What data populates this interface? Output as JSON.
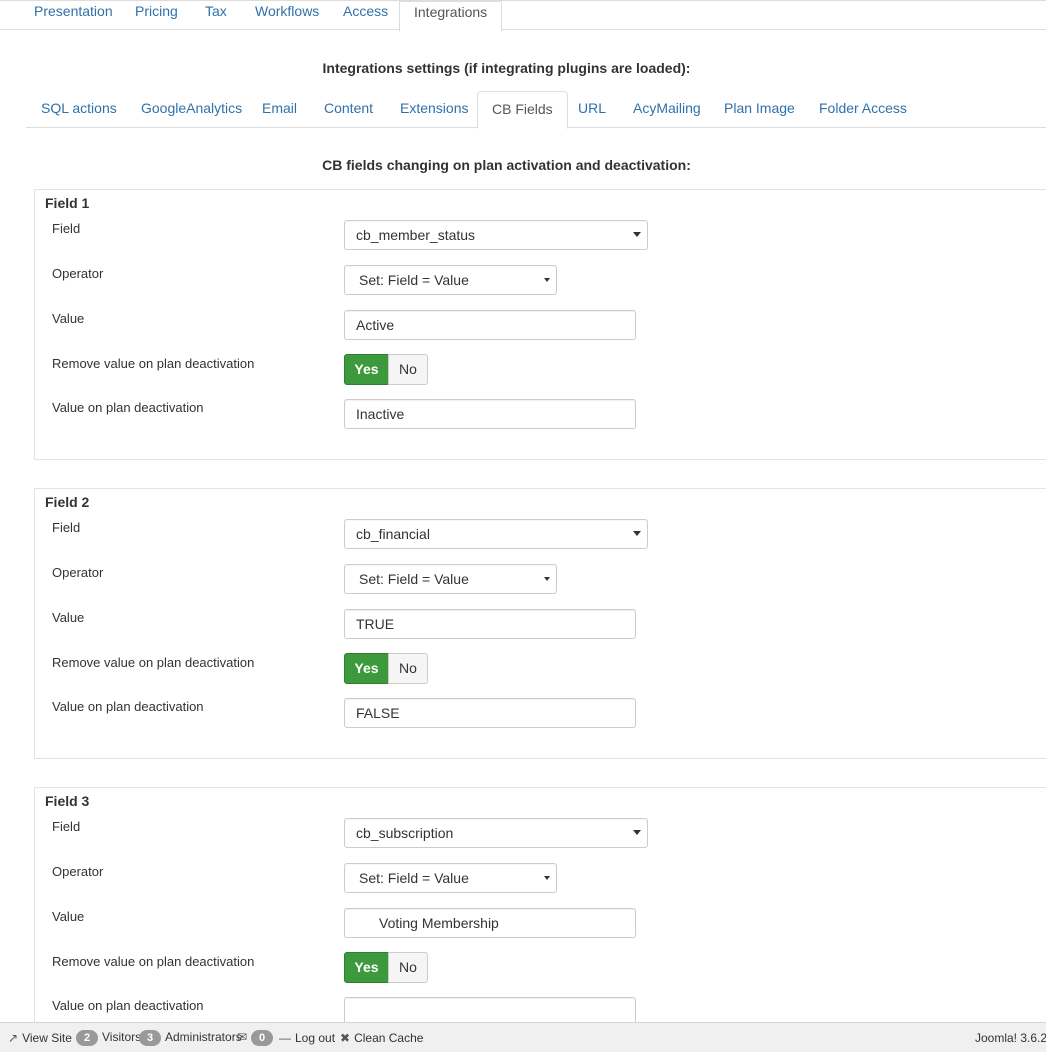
{
  "top_tabs": [
    "Presentation",
    "Pricing",
    "Tax",
    "Workflows",
    "Access",
    "Integrations"
  ],
  "top_active": "Integrations",
  "integrations_heading": "Integrations settings (if integrating plugins are loaded):",
  "sub_tabs": [
    "SQL actions",
    "GoogleAnalytics",
    "Email",
    "Content",
    "Extensions",
    "CB Fields",
    "URL",
    "AcyMailing",
    "Plan Image",
    "Folder Access"
  ],
  "sub_active": "CB Fields",
  "cb_heading": "CB fields changing on plan activation and deactivation:",
  "labels": {
    "field": "Field",
    "operator": "Operator",
    "value": "Value",
    "remove": "Remove value on plan deactivation",
    "deactivation": "Value on plan deactivation",
    "yes": "Yes",
    "no": "No"
  },
  "fields": [
    {
      "title": "Field 1",
      "field": "cb_member_status",
      "operator": "Set: Field = Value",
      "value": "Active",
      "remove": "Yes",
      "deactivation_value": "Inactive"
    },
    {
      "title": "Field 2",
      "field": "cb_financial",
      "operator": "Set: Field = Value",
      "value": "TRUE",
      "remove": "Yes",
      "deactivation_value": "FALSE"
    },
    {
      "title": "Field 3",
      "field": "cb_subscription",
      "operator": "Set: Field = Value",
      "value": "Voting Membership",
      "remove": "Yes",
      "deactivation_value": ""
    }
  ],
  "status_bar": {
    "view_site": "View Site",
    "visitors_count": "2",
    "visitors_label": "Visitors",
    "admins_count": "3",
    "admins_label": "Administrators",
    "messages_count": "0",
    "logout": "Log out",
    "clean_cache": "Clean Cache",
    "version": "Joomla! 3.6.2"
  },
  "colors": {
    "link": "#3071a9",
    "yes_active": "#3c9a3c",
    "badge": "#999999"
  }
}
